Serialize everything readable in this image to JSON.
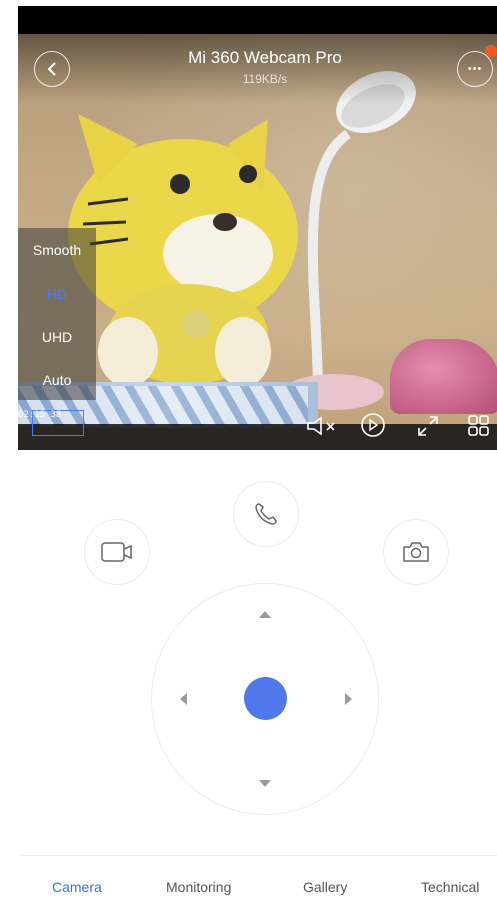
{
  "header": {
    "title": "Mi 360 Webcam Pro",
    "speed": "119KB/s",
    "more_label": "•••"
  },
  "quality_menu": {
    "items": [
      "Smooth",
      "HD",
      "UHD",
      "Auto"
    ],
    "selected": "HD"
  },
  "video": {
    "timestamp": "02:15 38"
  },
  "controls": {
    "icons": [
      "mute-icon",
      "playback-icon",
      "fullscreen-icon",
      "grid-icon"
    ],
    "actions": [
      "video-record-icon",
      "phone-call-icon",
      "screenshot-icon"
    ]
  },
  "tabs": [
    "Camera",
    "Monitoring",
    "Gallery",
    "Technical"
  ],
  "active_tab": "Camera",
  "colors": {
    "accent": "#4e78ec",
    "notification": "#f05a1e"
  }
}
